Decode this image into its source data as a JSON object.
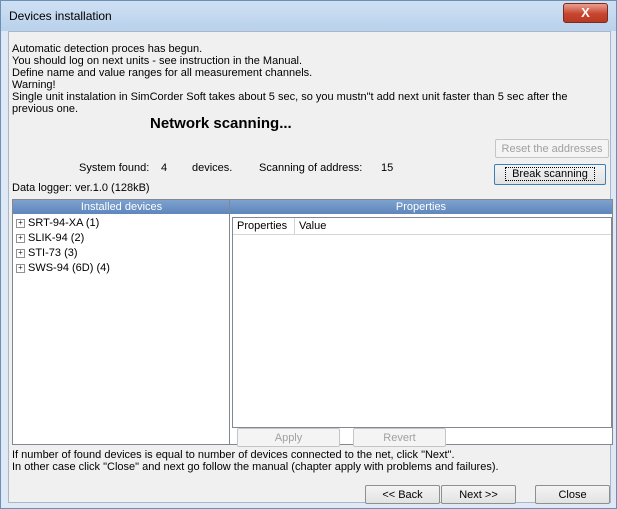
{
  "window": {
    "title": "Devices installation",
    "close_glyph": "X"
  },
  "instructions": [
    "Automatic detection proces has begun.",
    "You should log on next units - see instruction in the Manual.",
    "Define name and value ranges for all measurement channels.",
    "Warning!",
    "Single unit instalation in SimCorder Soft takes about 5 sec, so you mustn\"t add next unit faster than 5 sec after the",
    "previous one."
  ],
  "status": {
    "heading": "Network scanning...",
    "system_found_label": "System found:",
    "device_count": "4",
    "devices_label": "devices.",
    "scanning_label": "Scanning of address:",
    "scanning_address": "15",
    "data_logger": "Data logger: ver.1.0 (128kB)"
  },
  "buttons": {
    "reset": "Reset the addresses",
    "break": "Break scanning",
    "apply": "Apply",
    "revert": "Revert",
    "back": "<< Back",
    "next": "Next >>",
    "close": "Close"
  },
  "installed": {
    "header": "Installed devices",
    "items": [
      "SRT-94-XA (1)",
      "SLIK-94 (2)",
      "STI-73 (3)",
      "SWS-94 (6D) (4)"
    ]
  },
  "properties": {
    "header": "Properties",
    "columns": [
      "Properties",
      "Value"
    ]
  },
  "footer": [
    "If number of found devices is equal to number of devices connected to the net, click \"Next\".",
    "In other case click \"Close\" and next go follow the manual (chapter apply with problems and failures)."
  ],
  "colors": {
    "accent_header": "#6f93c6",
    "title_bar": "#c4d9ef",
    "close_button": "#c7452f"
  }
}
